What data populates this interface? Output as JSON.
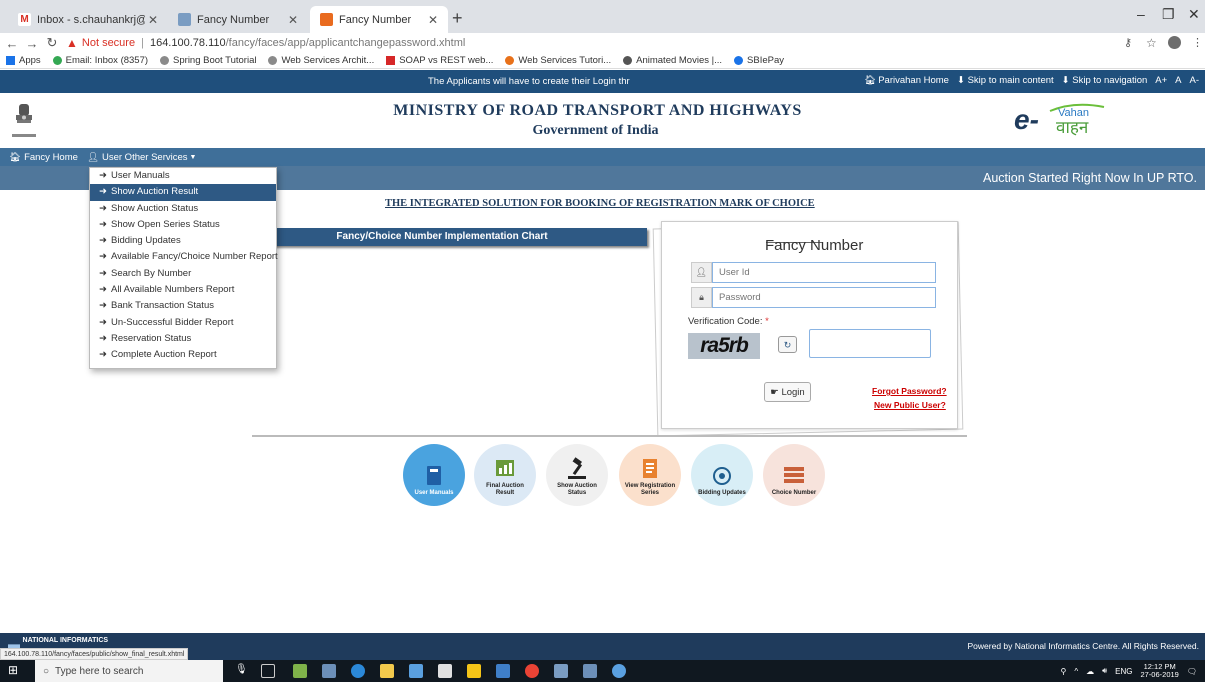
{
  "browser": {
    "tabs": [
      {
        "label": "Inbox - s.chauhankrj@gmail.com",
        "icon": "gmail-icon",
        "active": false
      },
      {
        "label": "Fancy Number",
        "icon": "fancy-number-icon",
        "active": false
      },
      {
        "label": "Fancy Number",
        "icon": "fancy-number-icon",
        "active": true
      }
    ],
    "not_secure": "Not secure",
    "url_host": "164.100.78.110",
    "url_path": "/fancy/faces/app/applicantchangepassword.xhtml",
    "bookmarks": [
      "Apps",
      "Email: Inbox (8357)",
      "Spring Boot Tutorial",
      "Web Services Archit...",
      "SOAP vs REST web...",
      "Web Services Tutori...",
      "Animated Movies |...",
      "SBIePay"
    ],
    "status_url": "164.100.78.110/fancy/faces/public/show_final_result.xhtml"
  },
  "site": {
    "ticker": "The Applicants will have to create their Login thr",
    "top_links": [
      "Parivahan Home",
      "Skip to main content",
      "Skip to navigation"
    ],
    "font_sizes": [
      "A+",
      "A",
      "A-"
    ],
    "ministry": "MINISTRY OF ROAD TRANSPORT AND HIGHWAYS",
    "government": "Government of India",
    "nav": {
      "home": "Fancy Home",
      "services": "User Other Services"
    },
    "auction_banner": "Auction Started Right Now In UP RTO.",
    "tagline": "THE INTEGRATED SOLUTION FOR BOOKING OF REGISTRATION MARK OF CHOICE",
    "chart_bar": "Fancy/Choice Number Implementation Chart",
    "dropdown": [
      {
        "label": "User Manuals",
        "selected": false
      },
      {
        "label": "Show Auction Result",
        "selected": true
      },
      {
        "label": "Show Auction Status",
        "selected": false
      },
      {
        "label": "Show Open Series Status",
        "selected": false
      },
      {
        "label": "Bidding Updates",
        "selected": false
      },
      {
        "label": "Available Fancy/Choice Number Report",
        "selected": false
      },
      {
        "label": "Search By Number",
        "selected": false
      },
      {
        "label": "All Available Numbers Report",
        "selected": false
      },
      {
        "label": "Bank Transaction Status",
        "selected": false
      },
      {
        "label": "Un-Successful Bidder Report",
        "selected": false
      },
      {
        "label": "Reservation Status",
        "selected": false
      },
      {
        "label": "Complete Auction Report",
        "selected": false
      }
    ]
  },
  "login": {
    "title": "Fancy Number",
    "user_placeholder": "User Id",
    "password_placeholder": "Password",
    "verification_label": "Verification Code:",
    "required_mark": "*",
    "captcha_text": "ra5rb",
    "login_button": "Login",
    "forgot": "Forgot Password?",
    "new_user": "New Public User?"
  },
  "quick_links": [
    {
      "label": "User Manuals",
      "color": "#4aa3df"
    },
    {
      "label": "Final Auction Result",
      "color": "#dce9f5"
    },
    {
      "label": "Show Auction Status",
      "color": "#f0f0f0"
    },
    {
      "label": "View Registration Series",
      "color": "#fbe0cc"
    },
    {
      "label": "Bidding Updates",
      "color": "#d8eef6"
    },
    {
      "label": "Choice Number",
      "color": "#f7e3dc"
    }
  ],
  "footer": {
    "nic": "NATIONAL INFORMATICS",
    "powered": "Powered by National Informatics Centre. All Rights Reserved."
  },
  "taskbar": {
    "search": "Type here to search",
    "lang": "ENG",
    "time": "12:12 PM",
    "date": "27-06-2019"
  }
}
